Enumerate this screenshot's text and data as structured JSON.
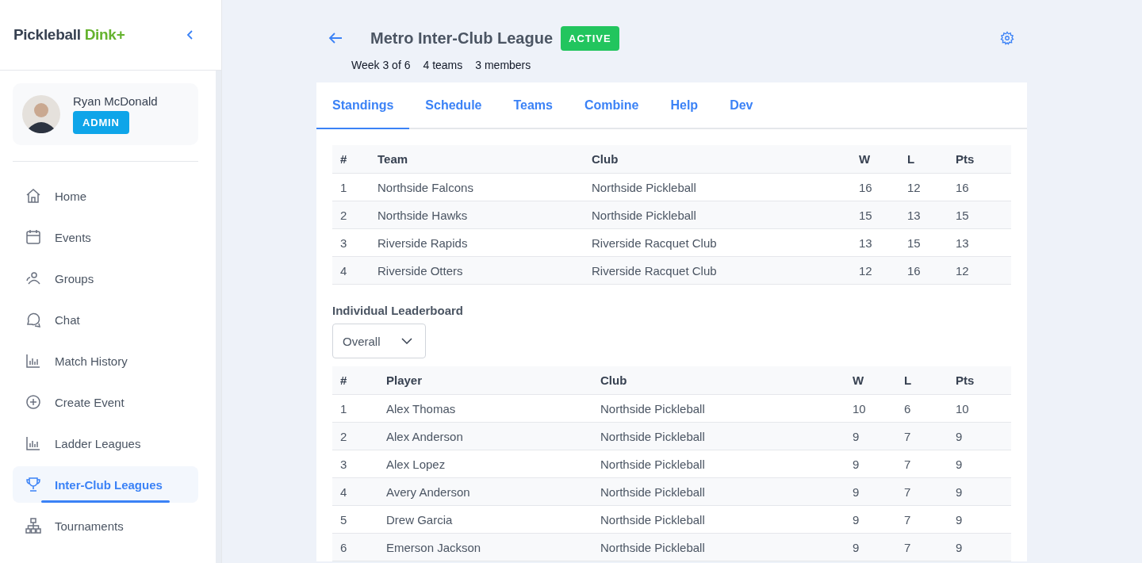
{
  "sidebar": {
    "brand": {
      "name": "Pickleball",
      "accent": "Dink+"
    },
    "user": {
      "name": "Ryan McDonald",
      "role": "ADMIN"
    },
    "items": [
      {
        "label": "Home",
        "kind": "home",
        "selected": false
      },
      {
        "label": "Events",
        "kind": "calendar",
        "selected": false
      },
      {
        "label": "Groups",
        "kind": "people",
        "selected": false
      },
      {
        "label": "Chat",
        "kind": "chat",
        "selected": false
      },
      {
        "label": "Match History",
        "kind": "chart",
        "selected": false
      },
      {
        "label": "Create Event",
        "kind": "plus",
        "selected": false
      },
      {
        "label": "Ladder Leagues",
        "kind": "chart",
        "selected": false
      },
      {
        "label": "Inter-Club Leagues",
        "kind": "trophy",
        "selected": true
      },
      {
        "label": "Tournaments",
        "kind": "bracket",
        "selected": false
      }
    ]
  },
  "header": {
    "title": "Metro Inter-Club League",
    "status": "ACTIVE",
    "meta": [
      "Week 3 of 6",
      "4 teams",
      "3 members"
    ]
  },
  "tabs": [
    {
      "label": "Standings",
      "selected": true
    },
    {
      "label": "Schedule",
      "selected": false
    },
    {
      "label": "Teams",
      "selected": false
    },
    {
      "label": "Combine",
      "selected": false
    },
    {
      "label": "Help",
      "selected": false
    },
    {
      "label": "Dev",
      "selected": false
    }
  ],
  "standings": {
    "columns": [
      "#",
      "Team",
      "Club",
      "W",
      "L",
      "Pts"
    ],
    "rows": [
      [
        "1",
        "Northside Falcons",
        "Northside Pickleball",
        "16",
        "12",
        "16"
      ],
      [
        "2",
        "Northside Hawks",
        "Northside Pickleball",
        "15",
        "13",
        "15"
      ],
      [
        "3",
        "Riverside Rapids",
        "Riverside Racquet Club",
        "13",
        "15",
        "13"
      ],
      [
        "4",
        "Riverside Otters",
        "Riverside Racquet Club",
        "12",
        "16",
        "12"
      ]
    ]
  },
  "leaderboard": {
    "title": "Individual Leaderboard",
    "filter": "Overall",
    "columns": [
      "#",
      "Player",
      "Club",
      "W",
      "L",
      "Pts"
    ],
    "rows": [
      [
        "1",
        "Alex Thomas",
        "Northside Pickleball",
        "10",
        "6",
        "10"
      ],
      [
        "2",
        "Alex Anderson",
        "Northside Pickleball",
        "9",
        "7",
        "9"
      ],
      [
        "3",
        "Alex Lopez",
        "Northside Pickleball",
        "9",
        "7",
        "9"
      ],
      [
        "4",
        "Avery Anderson",
        "Northside Pickleball",
        "9",
        "7",
        "9"
      ],
      [
        "5",
        "Drew Garcia",
        "Northside Pickleball",
        "9",
        "7",
        "9"
      ],
      [
        "6",
        "Emerson Jackson",
        "Northside Pickleball",
        "9",
        "7",
        "9"
      ]
    ]
  }
}
